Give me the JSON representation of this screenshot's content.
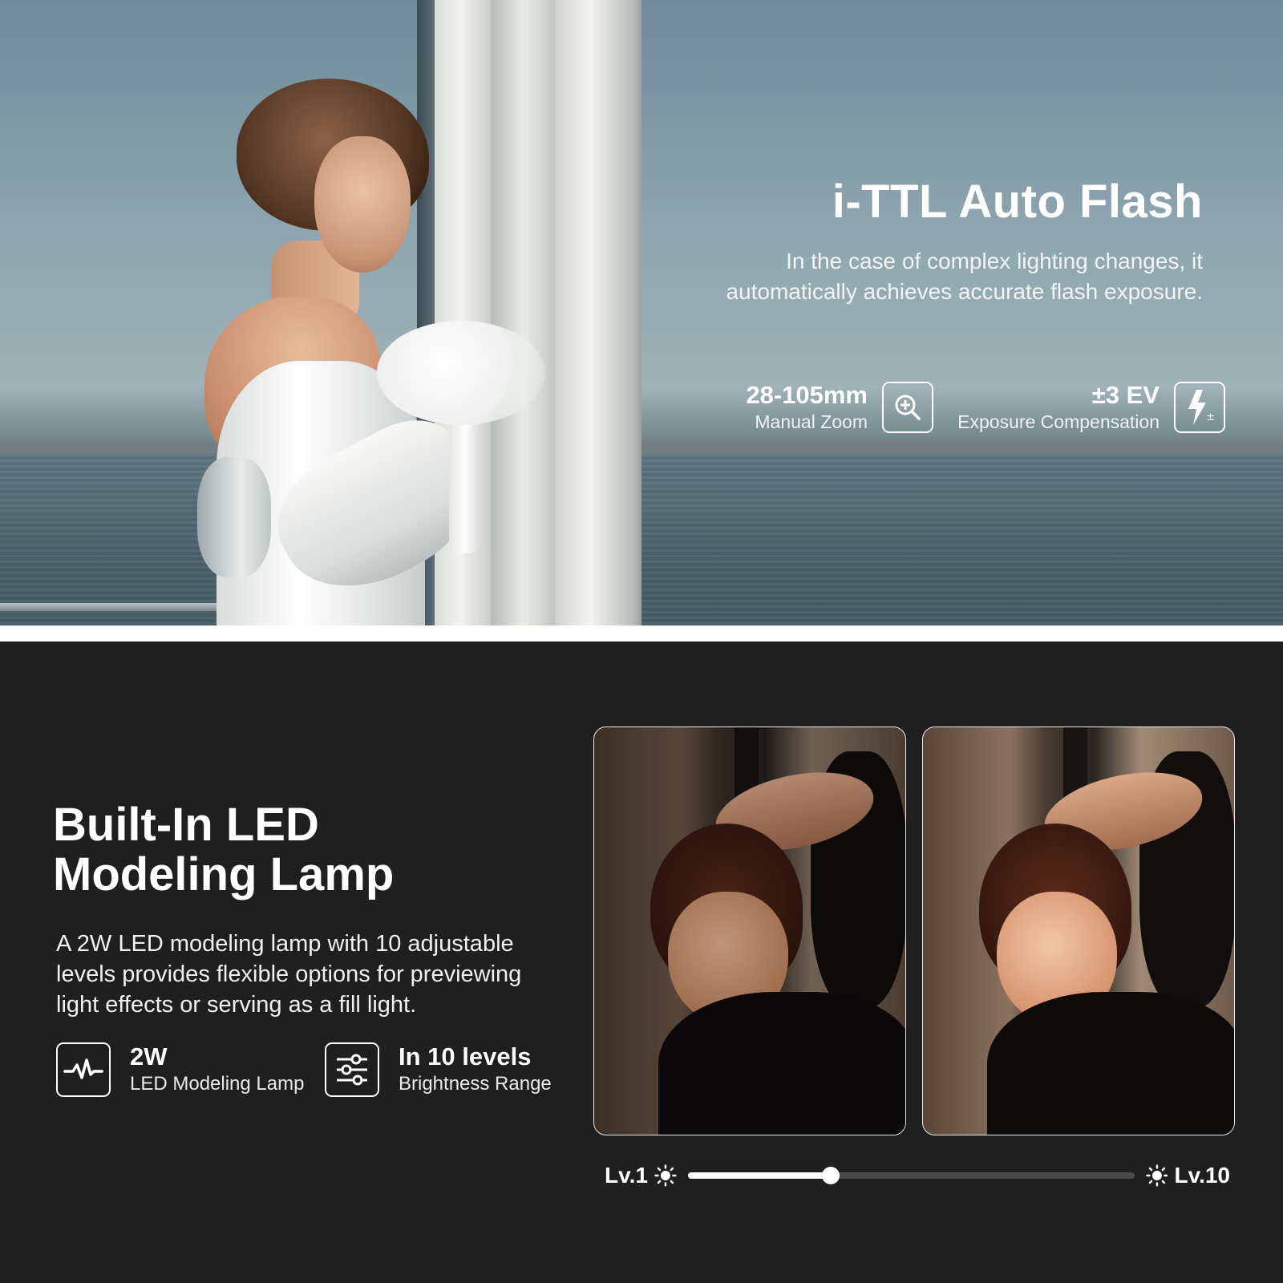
{
  "hero": {
    "title": "i-TTL Auto Flash",
    "description_line1": "In the case of complex lighting changes, it",
    "description_line2": "automatically achieves accurate flash exposure.",
    "specs": [
      {
        "value": "28-105mm",
        "label": "Manual Zoom",
        "icon": "zoom-in-icon"
      },
      {
        "value": "±3 EV",
        "label": "Exposure Compensation",
        "icon": "flash-exposure-icon"
      }
    ]
  },
  "lower": {
    "title_line1": "Built-In LED",
    "title_line2": "Modeling Lamp",
    "desc_line1": "A 2W LED modeling lamp with 10 adjustable",
    "desc_line2": "levels provides flexible options for previewing",
    "desc_line3": "light effects or serving as a fill light.",
    "features": [
      {
        "value": "2W",
        "label": "LED Modeling Lamp",
        "icon": "pulse-icon"
      },
      {
        "value": "In 10 levels",
        "label": "Brightness Range",
        "icon": "sliders-icon"
      }
    ],
    "slider": {
      "min_label": "Lv.1",
      "max_label": "Lv.10",
      "level_fraction": 0.32,
      "icon": "sun-icon"
    }
  },
  "colors": {
    "background_dark": "#1f1f1f",
    "text": "#ffffff",
    "track": "#4a4a4a"
  }
}
